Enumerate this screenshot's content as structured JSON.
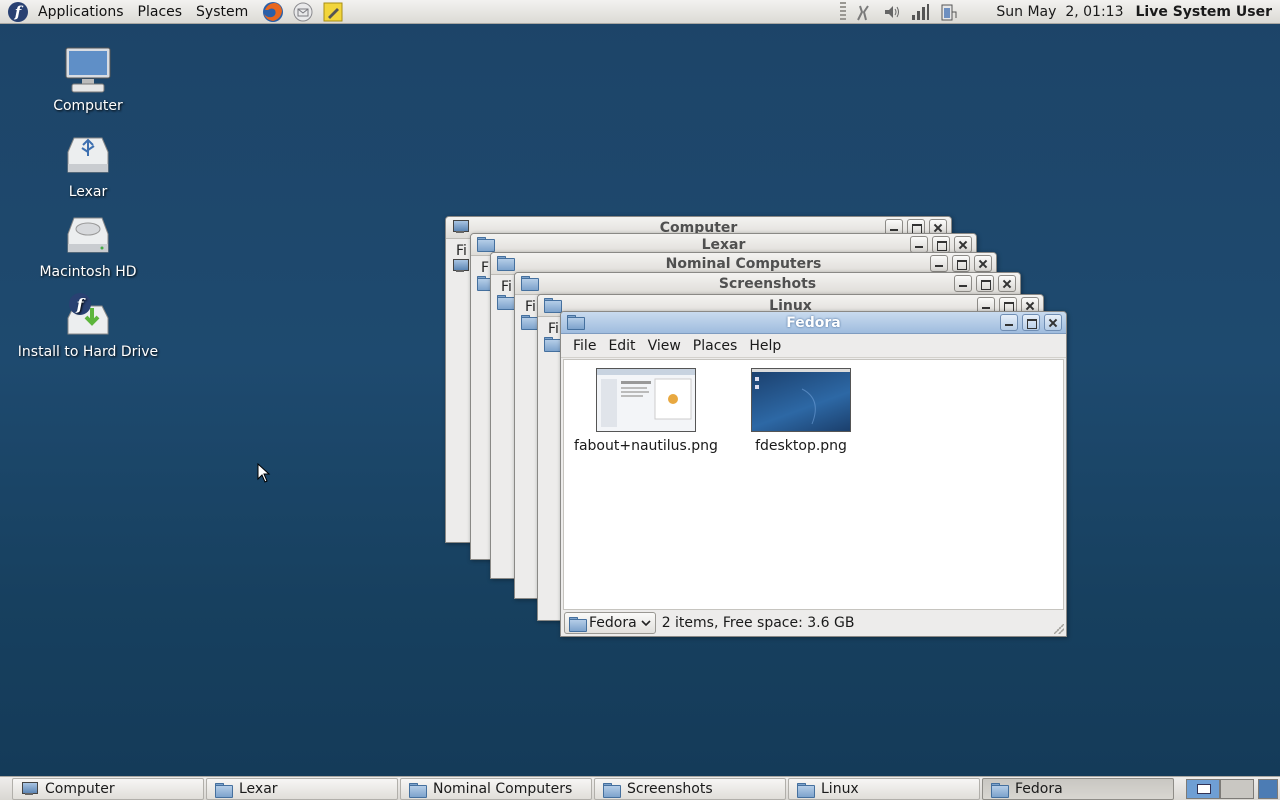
{
  "top_panel": {
    "menus": [
      "Applications",
      "Places",
      "System"
    ],
    "launchers": [
      "firefox-icon",
      "mail-icon",
      "notes-icon"
    ],
    "clock": "Sun May  2, 01:13",
    "user": "Live System User",
    "tray": [
      "network-icon",
      "volume-icon",
      "signal-icon",
      "battery-icon"
    ]
  },
  "desktop": {
    "icons": [
      {
        "label": "Computer",
        "icon": "computer-icon"
      },
      {
        "label": "Lexar",
        "icon": "usb-drive-icon"
      },
      {
        "label": "Macintosh HD",
        "icon": "hard-drive-icon"
      },
      {
        "label": "Install to Hard Drive",
        "icon": "install-icon"
      }
    ]
  },
  "windows": [
    {
      "title": "Computer",
      "menu_stub": "Fi"
    },
    {
      "title": "Lexar",
      "menu_stub": "F"
    },
    {
      "title": "Nominal Computers",
      "menu_stub": "Fi"
    },
    {
      "title": "Screenshots",
      "menu_stub": "Fi"
    },
    {
      "title": "Linux",
      "menu_stub": "Fi"
    }
  ],
  "fedora_window": {
    "title": "Fedora",
    "menus": [
      "File",
      "Edit",
      "View",
      "Places",
      "Help"
    ],
    "files": [
      {
        "name": "fabout+nautilus.png"
      },
      {
        "name": "fdesktop.png"
      }
    ],
    "location": "Fedora",
    "status": "2 items, Free space: 3.6 GB"
  },
  "taskbar": {
    "tasks": [
      "Computer",
      "Lexar",
      "Nominal Computers",
      "Screenshots",
      "Linux",
      "Fedora"
    ],
    "active": "Fedora"
  },
  "colors": {
    "desktop": "#1e4a6f",
    "title_active": "#9fbcde",
    "panel": "#e4e2de"
  }
}
